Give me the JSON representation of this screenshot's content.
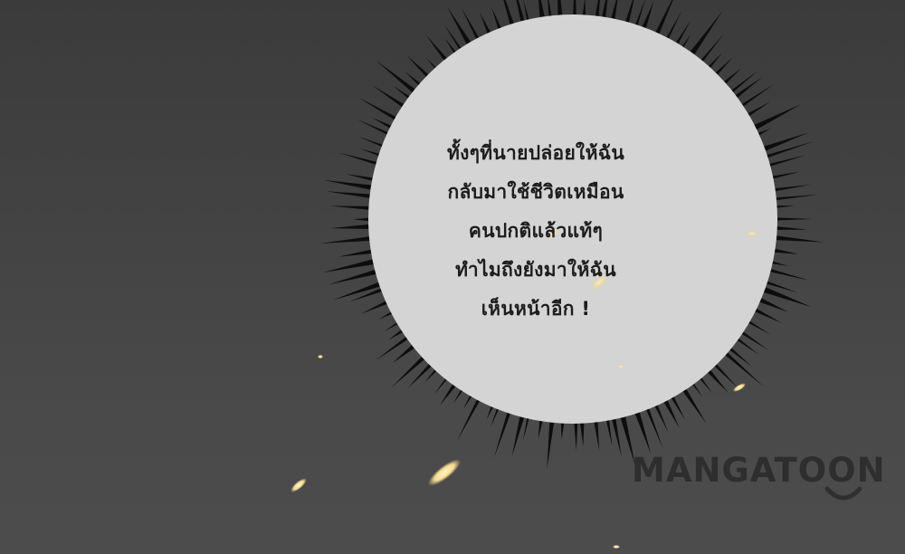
{
  "speech_bubble": {
    "lines": [
      "ทั้งๆที่นายปล่อยให้ฉัน",
      "กลับมาใช้ชีวิตเหมือน",
      "คนปกติแล้วแท้ๆ",
      "ทำไมถึงยังมาให้ฉัน",
      "เห็นหน้าอีก !"
    ],
    "fill_color": "#d4d4d4",
    "burst_color": "#0d0d0d"
  },
  "watermark": {
    "text": "MANGATOON"
  },
  "background": {
    "color": "#444444",
    "ember_color": "#f3dc8c"
  }
}
